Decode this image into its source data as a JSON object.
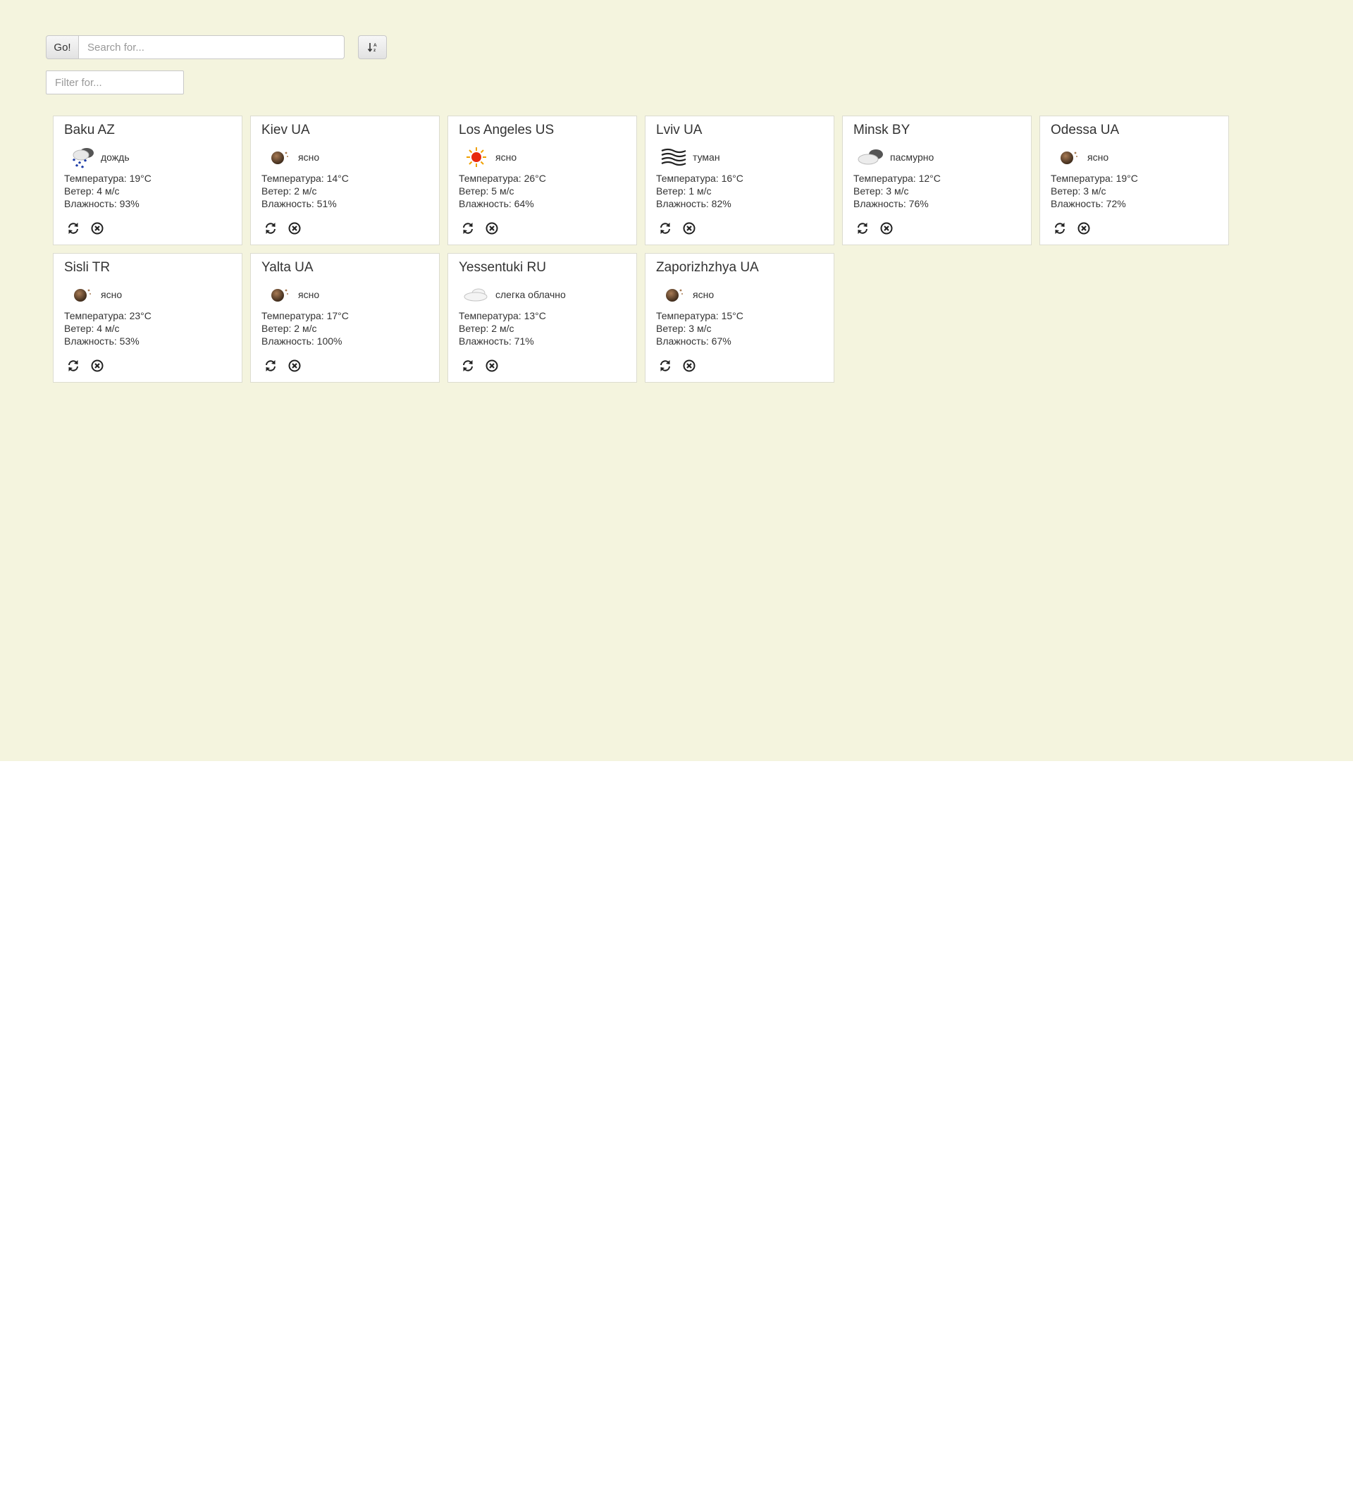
{
  "toolbar": {
    "go_label": "Go!",
    "search_placeholder": "Search for...",
    "filter_placeholder": "Filter for..."
  },
  "cards": [
    {
      "city": "Baku AZ",
      "condition": "дождь",
      "icon": "rain-icon",
      "temperature": "Температура: 19°C",
      "wind": "Ветер: 4 м/с",
      "humidity": "Влажность: 93%"
    },
    {
      "city": "Kiev UA",
      "condition": "ясно",
      "icon": "clear-night-icon",
      "temperature": "Температура: 14°C",
      "wind": "Ветер: 2 м/с",
      "humidity": "Влажность: 51%"
    },
    {
      "city": "Los Angeles US",
      "condition": "ясно",
      "icon": "sun-icon",
      "temperature": "Температура: 26°C",
      "wind": "Ветер: 5 м/с",
      "humidity": "Влажность: 64%"
    },
    {
      "city": "Lviv UA",
      "condition": "туман",
      "icon": "fog-icon",
      "temperature": "Температура: 16°C",
      "wind": "Ветер: 1 м/с",
      "humidity": "Влажность: 82%"
    },
    {
      "city": "Minsk BY",
      "condition": "пасмурно",
      "icon": "overcast-icon",
      "temperature": "Температура: 12°C",
      "wind": "Ветер: 3 м/с",
      "humidity": "Влажность: 76%"
    },
    {
      "city": "Odessa UA",
      "condition": "ясно",
      "icon": "clear-night-icon",
      "temperature": "Температура: 19°C",
      "wind": "Ветер: 3 м/с",
      "humidity": "Влажность: 72%"
    },
    {
      "city": "Sisli TR",
      "condition": "ясно",
      "icon": "clear-night-icon",
      "temperature": "Температура: 23°C",
      "wind": "Ветер: 4 м/с",
      "humidity": "Влажность: 53%"
    },
    {
      "city": "Yalta UA",
      "condition": "ясно",
      "icon": "clear-night-icon",
      "temperature": "Температура: 17°C",
      "wind": "Ветер: 2 м/с",
      "humidity": "Влажность: 100%"
    },
    {
      "city": "Yessentuki RU",
      "condition": "слегка облачно",
      "icon": "cloud-icon",
      "temperature": "Температура: 13°C",
      "wind": "Ветер: 2 м/с",
      "humidity": "Влажность: 71%"
    },
    {
      "city": "Zaporizhzhya UA",
      "condition": "ясно",
      "icon": "clear-night-icon",
      "temperature": "Температура: 15°C",
      "wind": "Ветер: 3 м/с",
      "humidity": "Влажность: 67%"
    }
  ]
}
